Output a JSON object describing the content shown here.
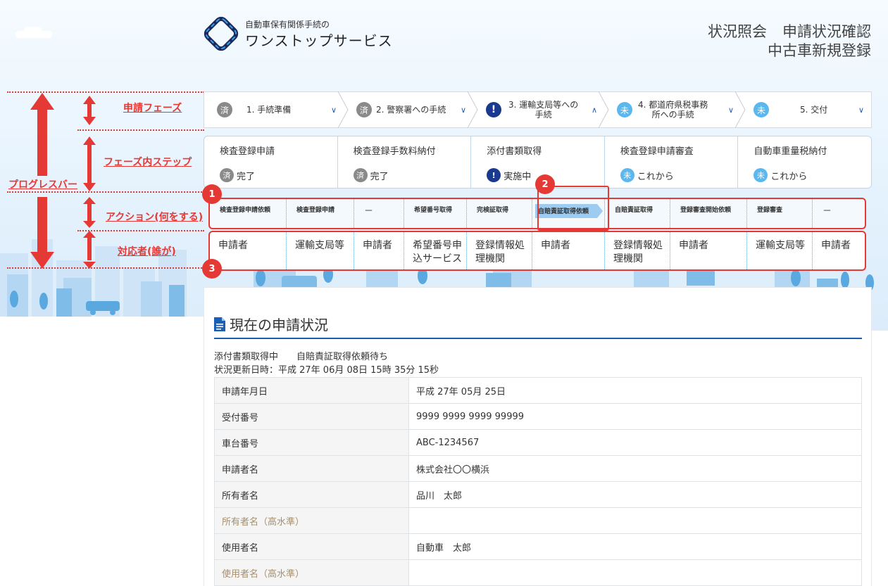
{
  "header": {
    "logo_small": "自動車保有関係手続の",
    "logo_main": "ワンストップサービス",
    "title_line1_a": "状況照会",
    "title_line1_b": "申請状況確認",
    "title_line2": "中古車新規登録"
  },
  "annotations": {
    "phase_label": "申請フェーズ",
    "step_label": "フェーズ内ステップ",
    "progress_label": "プログレスバー",
    "action_label": "アクション(何をする)",
    "actor_label": "対応者(誰が)",
    "markers": [
      "1",
      "2",
      "3"
    ]
  },
  "phases": [
    {
      "badge": "済",
      "state": "done",
      "label": "1. 手続準備"
    },
    {
      "badge": "済",
      "state": "done",
      "label": "2. 警察署への手続"
    },
    {
      "badge": "!",
      "state": "current",
      "label_line1": "3. 運輸支局等への",
      "label_line2": "手続"
    },
    {
      "badge": "未",
      "state": "todo",
      "label_line1": "4. 都道府県税事務",
      "label_line2": "所への手続"
    },
    {
      "badge": "未",
      "state": "todo",
      "label": "5. 交付"
    }
  ],
  "steps": [
    {
      "name": "検査登録申請",
      "badge": "済",
      "status": "完了"
    },
    {
      "name": "検査登録手数料納付",
      "badge": "済",
      "status": "完了"
    },
    {
      "name": "添付書類取得",
      "badge": "!",
      "status": "実施中"
    },
    {
      "name": "検査登録申請審査",
      "badge": "未",
      "status": "これから"
    },
    {
      "name": "自動車重量税納付",
      "badge": "未",
      "status": "これから"
    }
  ],
  "actions": [
    "検査登録申請依頼",
    "検査登録申請",
    "－",
    "希望番号取得",
    "完検証取得",
    "自賠責証取得依頼",
    "自賠責証取得",
    "登録審査開始依頼",
    "登録審査",
    "－"
  ],
  "actors": [
    {
      "l1": "申請者",
      "l2": ""
    },
    {
      "l1": "運輸支局等",
      "l2": ""
    },
    {
      "l1": "申請者",
      "l2": ""
    },
    {
      "l1": "希望番号申",
      "l2": "込サービス"
    },
    {
      "l1": "登録情報処",
      "l2": "理機関"
    },
    {
      "l1": "申請者",
      "l2": ""
    },
    {
      "l1": "登録情報処",
      "l2": "理機関"
    },
    {
      "l1": "申請者",
      "l2": ""
    },
    {
      "l1": "運輸支局等",
      "l2": ""
    },
    {
      "l1": "申請者",
      "l2": ""
    }
  ],
  "status": {
    "title": "現在の申請状況",
    "phase_state": "添付書類取得中",
    "step_state": "自賠責証取得依頼待ち",
    "updated": "状況更新日時：平成 27年 06月 08日 15時 35分 15秒",
    "rows": [
      {
        "key": "申請年月日",
        "value": "平成 27年 05月 25日",
        "muted": false
      },
      {
        "key": "受付番号",
        "value": "9999 9999 9999 99999",
        "muted": false
      },
      {
        "key": "車台番号",
        "value": "ABC-1234567",
        "muted": false
      },
      {
        "key": "申請者名",
        "value": "株式会社〇〇横浜",
        "muted": false
      },
      {
        "key": "所有者名",
        "value": "品川　太郎",
        "muted": false
      },
      {
        "key": "所有者名（高水準）",
        "value": "",
        "muted": true
      },
      {
        "key": "使用者名",
        "value": "自動車　太郎",
        "muted": false
      },
      {
        "key": "使用者名（高水準）",
        "value": "",
        "muted": true
      }
    ]
  },
  "colors": {
    "accent": "#1a5fb4",
    "annotation": "#e53935",
    "done": "#8a8a8a",
    "current": "#1a3a8f",
    "todo": "#5bb8ef"
  }
}
